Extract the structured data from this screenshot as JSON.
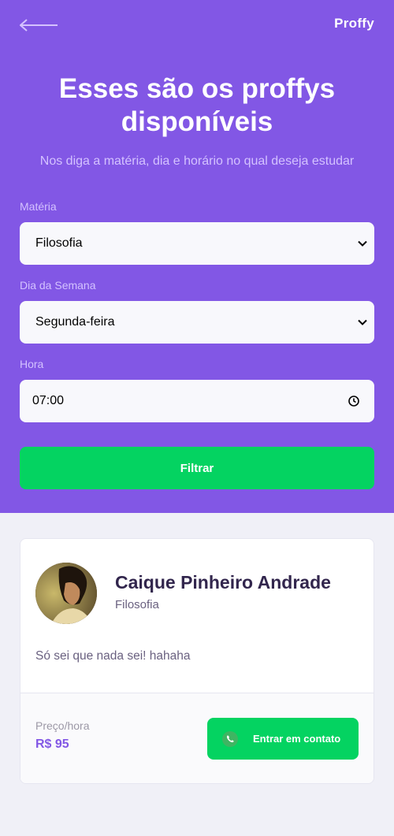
{
  "header": {
    "logo": "Proffy",
    "title": "Esses são os proffys disponíveis",
    "subtitle": "Nos diga a matéria, dia e horário no qual deseja estudar"
  },
  "filters": {
    "subject_label": "Matéria",
    "subject_value": "Filosofia",
    "weekday_label": "Dia da Semana",
    "weekday_value": "Segunda-feira",
    "time_label": "Hora",
    "time_value": "07:00",
    "submit_label": "Filtrar"
  },
  "teacher": {
    "name": "Caique Pinheiro Andrade",
    "subject": "Filosofia",
    "bio": "Só sei que nada sei! hahaha",
    "price_label": "Preço/hora",
    "price": "R$ 95",
    "contact_label": "Entrar em contato"
  },
  "colors": {
    "primary": "#8257e5",
    "secondary": "#04d361",
    "background": "#f0f0f7"
  }
}
